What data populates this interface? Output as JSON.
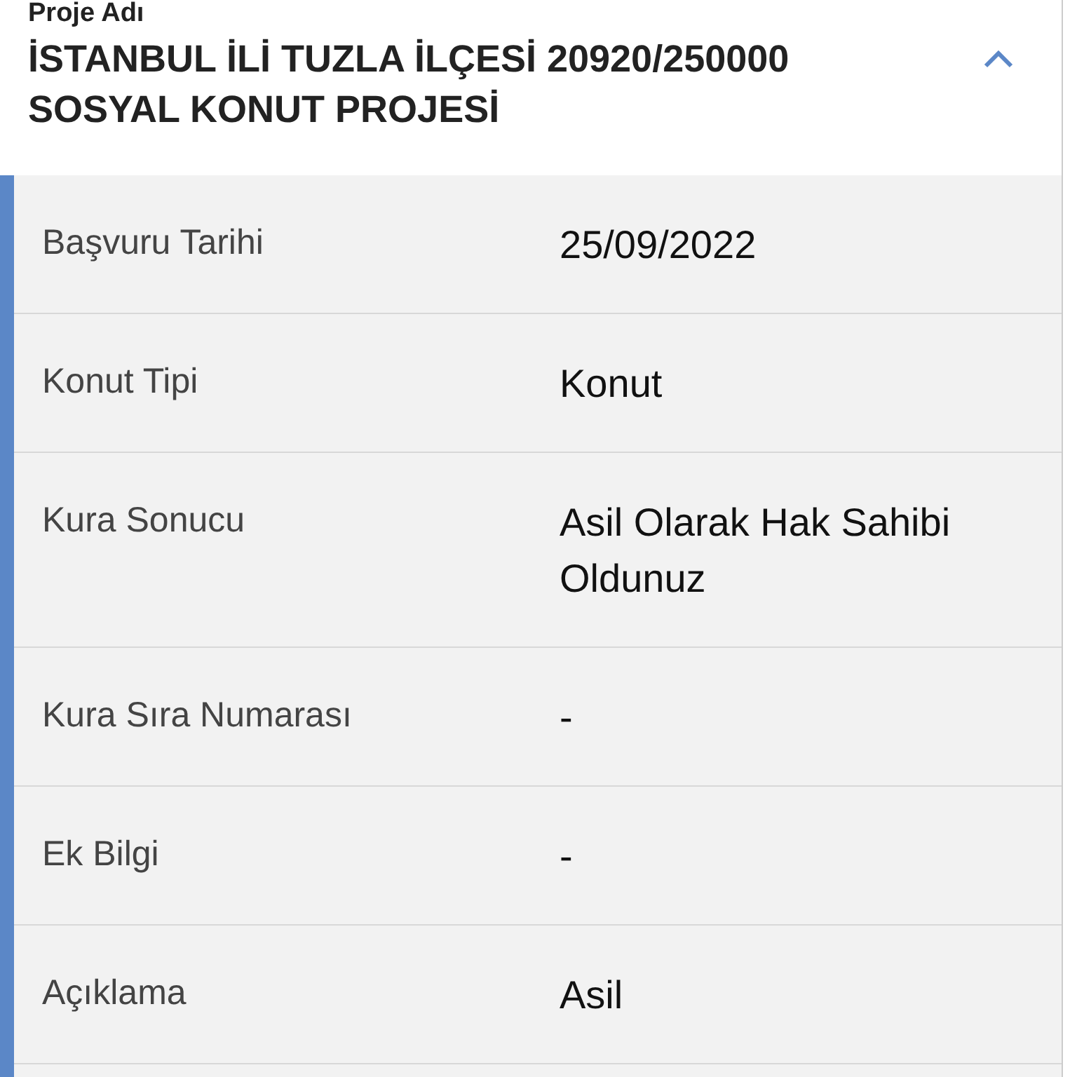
{
  "project": {
    "label": "Proje Adı",
    "title": "İSTANBUL İLİ TUZLA İLÇESİ 20920/250000 SOSYAL KONUT PROJESİ",
    "expanded": true
  },
  "rows": [
    {
      "label": "Başvuru Tarihi",
      "value": "25/09/2022"
    },
    {
      "label": "Konut Tipi",
      "value": "Konut"
    },
    {
      "label": "Kura Sonucu",
      "value": "Asil Olarak Hak Sahibi Oldunuz"
    },
    {
      "label": "Kura Sıra Numarası",
      "value": "-"
    },
    {
      "label": "Ek Bilgi",
      "value": "-"
    },
    {
      "label": "Açıklama",
      "value": "Asil"
    }
  ]
}
